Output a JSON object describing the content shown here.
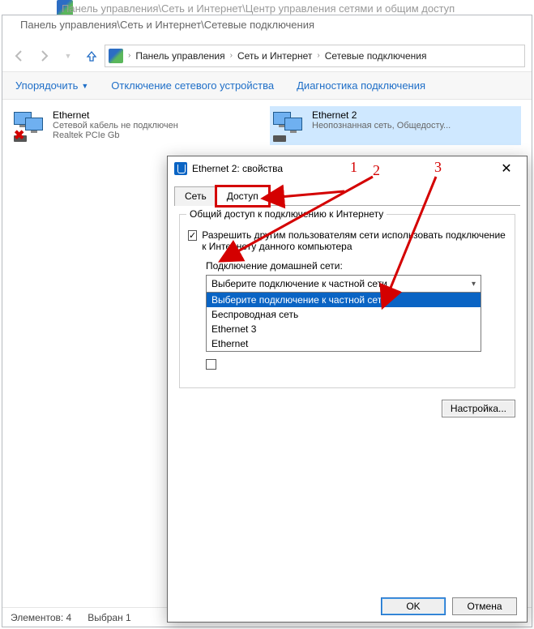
{
  "background": {
    "title_full": "Панель управления\\Сеть и Интернет\\Центр управления сетями и общим доступ",
    "title_window": "Панель управления\\Сеть и Интернет\\Сетевые подключения"
  },
  "breadcrumb": {
    "items": [
      "Панель управления",
      "Сеть и Интернет",
      "Сетевые подключения"
    ]
  },
  "toolbar": {
    "organize": "Упорядочить",
    "disable": "Отключение сетевого устройства",
    "diagnose": "Диагностика подключения"
  },
  "connections": [
    {
      "name": "Ethernet",
      "status": "Сетевой кабель не подключен",
      "adapter": "Realtek PCIe Gb",
      "disconnected": true
    },
    {
      "name": "Ethernet 2",
      "status": "Неопознанная сеть, Общедосту...",
      "adapter": "",
      "disconnected": false,
      "selected": true
    }
  ],
  "statusbar": {
    "count_label": "Элементов: 4",
    "selected_label": "Выбран 1"
  },
  "dialog": {
    "title": "Ethernet 2: свойства",
    "tabs": {
      "network": "Сеть",
      "sharing": "Доступ"
    },
    "group_title": "Общий доступ к подключению к Интернету",
    "allow_checkbox": "Разрешить другим пользователям сети использовать подключение к Интернету данного компьютера",
    "home_network_label": "Подключение домашней сети:",
    "dd_selected": "Выберите подключение к частной сети",
    "dd_options": [
      "Выберите подключение к частной сети",
      "Беспроводная сеть",
      "Ethernet 3",
      "Ethernet"
    ],
    "allow_control_checkbox": "",
    "settings_btn": "Настройка...",
    "ok": "OK",
    "cancel": "Отмена"
  },
  "annotations": {
    "n1": "1",
    "n2": "2",
    "n3": "3"
  }
}
